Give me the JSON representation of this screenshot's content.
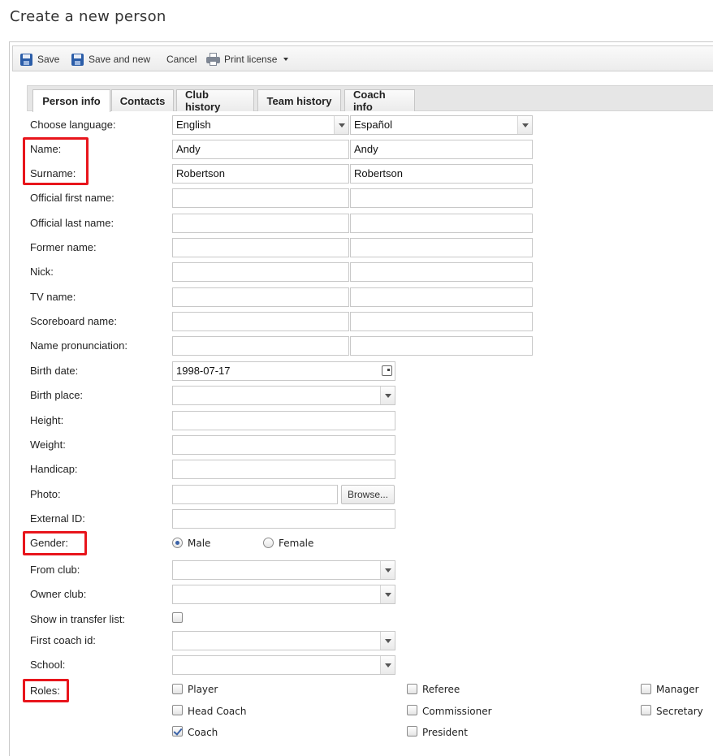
{
  "page": {
    "title": "Create a new person"
  },
  "toolbar": {
    "save": "Save",
    "save_and_new": "Save and new",
    "cancel": "Cancel",
    "print_license": "Print license"
  },
  "tabs": [
    {
      "label": "Person info",
      "active": true
    },
    {
      "label": "Contacts"
    },
    {
      "label": "Club history"
    },
    {
      "label": "Team history"
    },
    {
      "label": "Coach info"
    }
  ],
  "form": {
    "choose_language": {
      "label": "Choose language:",
      "value1": "English",
      "value2": "Español"
    },
    "name": {
      "label": "Name:",
      "value1": "Andy",
      "value2": "Andy"
    },
    "surname": {
      "label": "Surname:",
      "value1": "Robertson",
      "value2": "Robertson"
    },
    "official_first_name": {
      "label": "Official first name:",
      "value1": "",
      "value2": ""
    },
    "official_last_name": {
      "label": "Official last name:",
      "value1": "",
      "value2": ""
    },
    "former_name": {
      "label": "Former name:",
      "value1": "",
      "value2": ""
    },
    "nick": {
      "label": "Nick:",
      "value1": "",
      "value2": ""
    },
    "tv_name": {
      "label": "TV name:",
      "value1": "",
      "value2": ""
    },
    "scoreboard_name": {
      "label": "Scoreboard name:",
      "value1": "",
      "value2": ""
    },
    "name_pronunciation": {
      "label": "Name pronunciation:",
      "value1": "",
      "value2": ""
    },
    "birth_date": {
      "label": "Birth date:",
      "value": "1998-07-17"
    },
    "birth_place": {
      "label": "Birth place:",
      "value": ""
    },
    "height": {
      "label": "Height:",
      "value": ""
    },
    "weight": {
      "label": "Weight:",
      "value": ""
    },
    "handicap": {
      "label": "Handicap:",
      "value": ""
    },
    "photo": {
      "label": "Photo:",
      "value": "",
      "browse": "Browse..."
    },
    "external_id": {
      "label": "External ID:",
      "value": ""
    },
    "gender": {
      "label": "Gender:",
      "male": "Male",
      "female": "Female",
      "selected": "male"
    },
    "from_club": {
      "label": "From club:",
      "value": ""
    },
    "owner_club": {
      "label": "Owner club:",
      "value": ""
    },
    "show_in_transfer_list": {
      "label": "Show in transfer list:",
      "checked": false
    },
    "first_coach_id": {
      "label": "First coach id:",
      "value": ""
    },
    "school": {
      "label": "School:",
      "value": ""
    },
    "roles": {
      "label": "Roles:",
      "items": [
        {
          "label": "Player",
          "checked": false
        },
        {
          "label": "Referee",
          "checked": false
        },
        {
          "label": "Manager",
          "checked": false
        },
        {
          "label": "Head Coach",
          "checked": false
        },
        {
          "label": "Commissioner",
          "checked": false
        },
        {
          "label": "Secretary",
          "checked": false
        },
        {
          "label": "Coach",
          "checked": true
        },
        {
          "label": "President",
          "checked": false
        }
      ]
    }
  },
  "colors": {
    "highlight": "#e8151c",
    "accent": "#3a62a8"
  }
}
